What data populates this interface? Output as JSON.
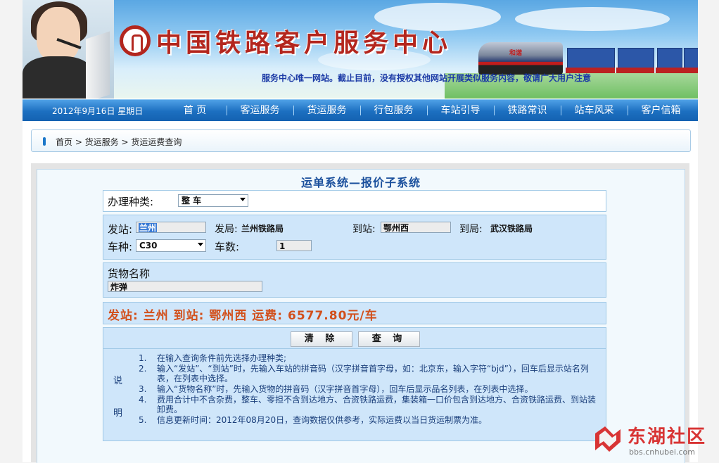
{
  "banner": {
    "title": "中国铁路客户服务中心",
    "notice": "服务中心唯一网站。截止目前，没有授权其他网站开展类似服务内容，敬请广大用户注意",
    "loco_label": "和谐"
  },
  "nav": {
    "date": "2012年9月16日  星期日",
    "items": [
      "首  页",
      "客运服务",
      "货运服务",
      "行包服务",
      "车站引导",
      "铁路常识",
      "站车风采",
      "客户信箱"
    ]
  },
  "breadcrumb": "首页 > 货运服务 > 货运运费查询",
  "system_title": "运单系统—报价子系统",
  "form": {
    "type_label": "办理种类:",
    "type_value": "整    车",
    "from_station_label": "发站:",
    "from_station_value": "兰州",
    "from_bureau_label": "发局:",
    "from_bureau_value": "兰州铁路局",
    "to_station_label": "到站:",
    "to_station_value": "鄂州西",
    "to_bureau_label": "到局:",
    "to_bureau_value": "武汉铁路局",
    "car_type_label": "车种:",
    "car_type_value": "C30",
    "car_count_label": "车数:",
    "car_count_value": "1",
    "goods_label": "货物名称",
    "goods_value": "炸弹"
  },
  "result": "发站: 兰州  到站: 鄂州西  运费: 6577.80元/车",
  "buttons": {
    "clear": "清  除",
    "query": "查  询"
  },
  "notes": {
    "side_label_1": "说",
    "side_label_2": "明",
    "items": [
      {
        "num": "1.",
        "text": "在输入查询条件前先选择办理种类;"
      },
      {
        "num": "2.",
        "text": "输入“发站”、“到站”时，先输入车站的拼音码（汉字拼音首字母，如：北京东，输入字符“bjd”），回车后显示站名列表，在列表中选择。"
      },
      {
        "num": "3.",
        "text": "输入“货物名称”时，先输入货物的拼音码（汉字拼音首字母），回车后显示品名列表，在列表中选择。"
      },
      {
        "num": "4.",
        "text": "费用合计中不含杂费，整车、零担不含到达地方、合资铁路运费，集装箱一口价包含到达地方、合资铁路运费、到站装卸费。"
      },
      {
        "num": "5.",
        "text": "信息更新时间：2012年08月20日，查询数据仅供参考，实际运费以当日货运制票为准。"
      }
    ]
  },
  "watermark": {
    "text": "东湖社区",
    "url": "bbs.cnhubei.com"
  },
  "colors": {
    "nav_blue": "#1c6fc0",
    "title_red": "#b3261e",
    "result_orange": "#d2501c",
    "notice_blue": "#1b3aa6"
  }
}
